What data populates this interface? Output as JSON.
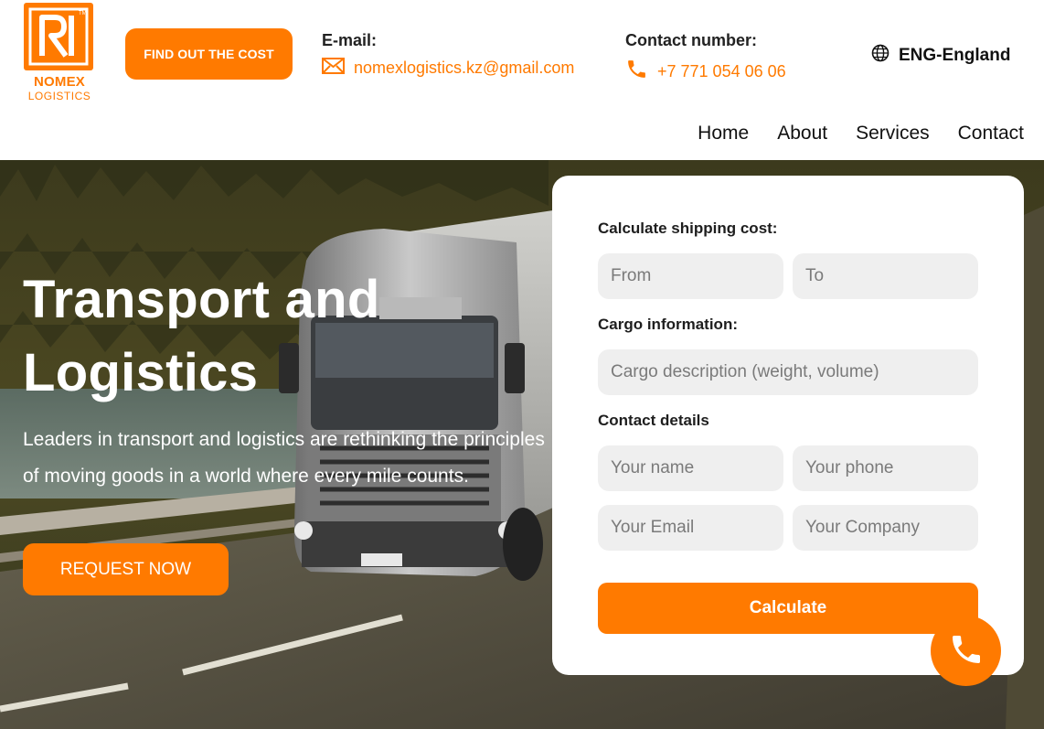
{
  "brand": {
    "name": "NOMEX",
    "subtitle": "LOGISTICS",
    "accent_color": "#ff7a00"
  },
  "header": {
    "cost_button_label": "FIND OUT THE COST",
    "email_label": "E-mail:",
    "email_value": "nomexlogistics.kz@gmail.com",
    "email_icon": "envelope-icon",
    "phone_label": "Contact number:",
    "phone_value": "+7 771 054 06 06",
    "phone_icon": "phone-icon",
    "language": "ENG-England",
    "language_icon": "globe-icon"
  },
  "nav": {
    "items": [
      {
        "label": "Home"
      },
      {
        "label": "About"
      },
      {
        "label": "Services"
      },
      {
        "label": "Contact"
      }
    ]
  },
  "hero": {
    "title": "Transport and Logistics",
    "text": "Leaders in transport and logistics are rethinking the principles of moving goods in a world where every mile counts.",
    "cta_label": "REQUEST NOW"
  },
  "form": {
    "shipping_label": "Calculate shipping cost:",
    "from_placeholder": "From",
    "to_placeholder": "To",
    "cargo_label": "Cargo information:",
    "cargo_placeholder": "Cargo description (weight, volume)",
    "contact_label": "Contact details",
    "name_placeholder": "Your name",
    "phone_placeholder": "Your phone",
    "email_placeholder": "Your Email",
    "company_placeholder": "Your Company",
    "submit_label": "Calculate"
  },
  "floating": {
    "call_icon": "phone-icon"
  }
}
